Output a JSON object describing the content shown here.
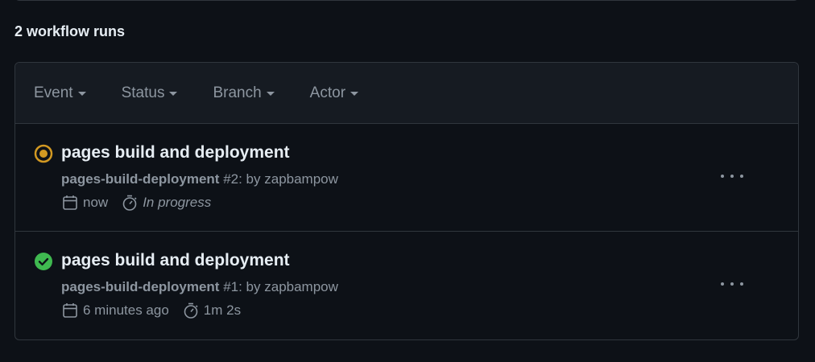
{
  "runs_count": "2 workflow runs",
  "filters": [
    {
      "label": "Event"
    },
    {
      "label": "Status"
    },
    {
      "label": "Branch"
    },
    {
      "label": "Actor"
    }
  ],
  "runs": [
    {
      "status": "in-progress",
      "status_icon": "in-progress-icon",
      "title": "pages build and deployment",
      "workflow": "pages-build-deployment",
      "run_number": " #2",
      "by": ": by zapbampow",
      "time": "now",
      "duration": "In progress"
    },
    {
      "status": "success",
      "status_icon": "check-circle-icon",
      "title": "pages build and deployment",
      "workflow": "pages-build-deployment",
      "run_number": " #1",
      "by": ": by zapbampow",
      "time": "6 minutes ago",
      "duration": "1m 2s"
    }
  ],
  "colors": {
    "background": "#0d1117",
    "border": "#30363d",
    "muted": "#8d96a0",
    "in_progress": "#d29922",
    "success": "#3fb950"
  }
}
